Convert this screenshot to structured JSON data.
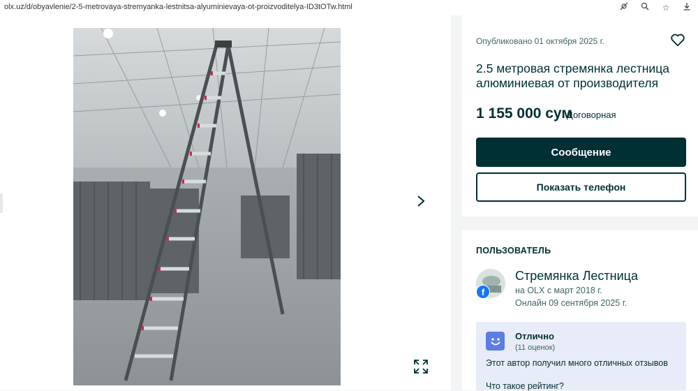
{
  "browser": {
    "url": "olx.uz/d/obyavlenie/2-5-metrovaya-stremyanka-lestnitsa-alyuminievaya-ot-proizvoditelya-ID3tOTw.html",
    "icons": [
      "eye-off-icon",
      "zoom-icon",
      "star-icon",
      "download-icon"
    ]
  },
  "gallery": {
    "image_alt": "2.5 метровая стремянка лестница алюминиевая от производителя"
  },
  "ad": {
    "published": "Опубликовано 01 октября 2025 г.",
    "title": "2.5 метровая стремянка лестница алюминиевая от производителя",
    "price": "1 155 000 сум",
    "negotiable": "Договорная",
    "message_button": "Сообщение",
    "phone_button": "Показать телефон"
  },
  "user": {
    "heading": "ПОЛЬЗОВАТЕЛЬ",
    "name": "Стремянка Лестница",
    "since": "на OLX с март 2018 г.",
    "online": "Онлайн 09 сентября 2025 г.",
    "badge": "f",
    "rating": {
      "label": "Отлично",
      "count": "(11 оценок)",
      "description": "Этот автор получил много отличных отзывов",
      "link": "Что такое рейтинг?"
    }
  },
  "colors": {
    "primary": "#002f34",
    "rating_bg": "#e8ecf9",
    "rating_icon": "#5a7de6",
    "facebook": "#1877f2"
  }
}
